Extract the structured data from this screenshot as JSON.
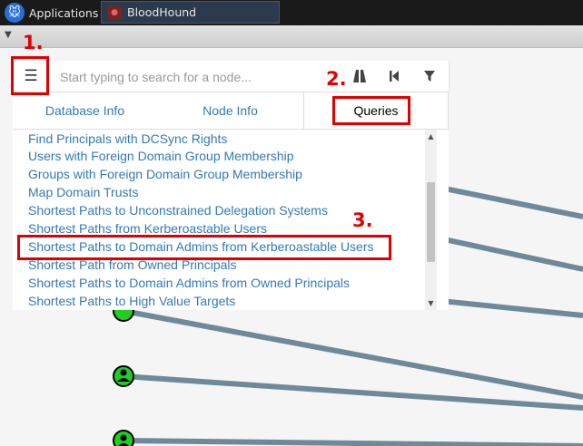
{
  "taskbar": {
    "applications_label": "Applications",
    "task_label": "BloodHound"
  },
  "search": {
    "placeholder": "Start typing to search for a node..."
  },
  "tabs": [
    {
      "label": "Database Info"
    },
    {
      "label": "Node Info"
    },
    {
      "label": "Queries"
    }
  ],
  "queries": [
    "Find Principals with DCSync Rights",
    "Users with Foreign Domain Group Membership",
    "Groups with Foreign Domain Group Membership",
    "Map Domain Trusts",
    "Shortest Paths to Unconstrained Delegation Systems",
    "Shortest Paths from Kerberoastable Users",
    "Shortest Paths to Domain Admins from Kerberoastable Users",
    "Shortest Path from Owned Principals",
    "Shortest Paths to Domain Admins from Owned Principals",
    "Shortest Paths to High Value Targets"
  ],
  "annotations": {
    "step1": "1.",
    "step2": "2.",
    "step3": "3."
  },
  "icons": {
    "menu": "hamburger-icon",
    "path": "road-icon",
    "back": "step-backward-icon",
    "filter": "filter-icon"
  },
  "colors": {
    "annotation": "#e00000",
    "link": "#337ab7",
    "node": "#22cc22",
    "edge": "#6e8a9a"
  }
}
